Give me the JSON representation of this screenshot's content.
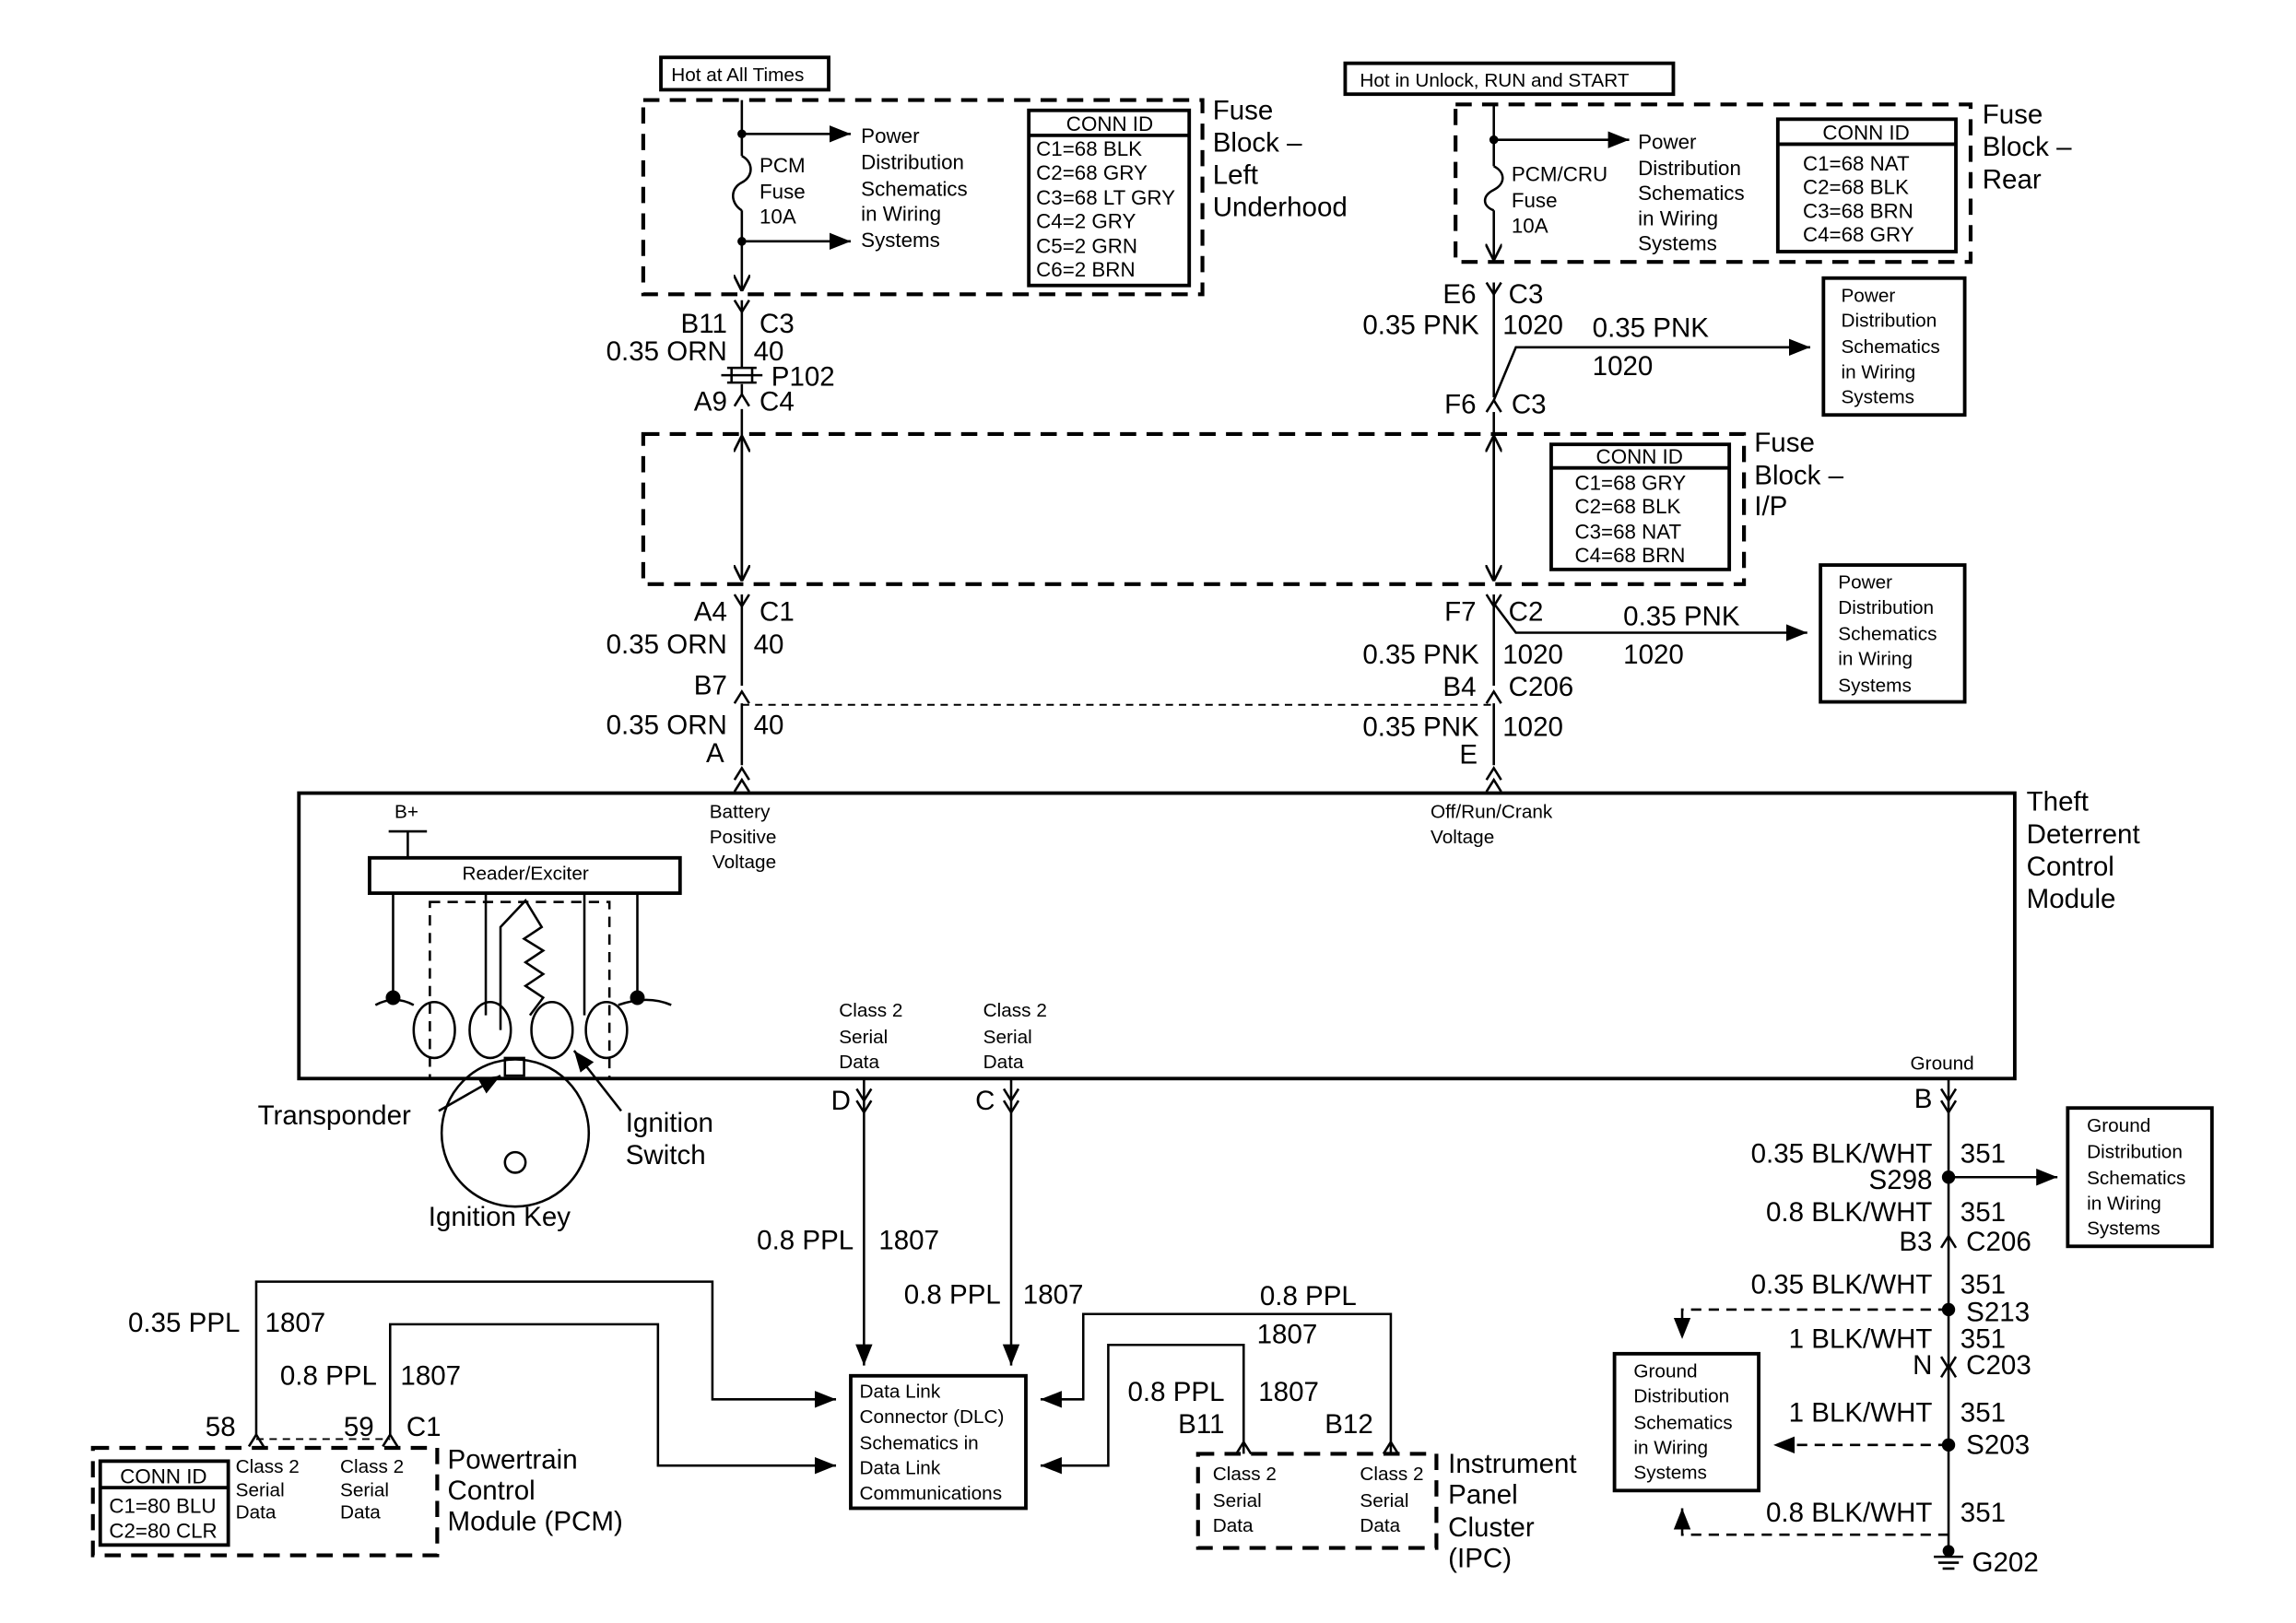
{
  "supply": {
    "hot_at_all_times": "Hot at All Times",
    "hot_in_unlock": "Hot in Unlock, RUN and START"
  },
  "fuse_block_left": {
    "title": [
      "Fuse",
      "Block –",
      "Left",
      "Underhood"
    ],
    "fuse": [
      "PCM",
      "Fuse",
      "10A"
    ],
    "power_dist": [
      "Power",
      "Distribution",
      "Schematics",
      "in Wiring",
      "Systems"
    ],
    "conn_id": {
      "header": "CONN ID",
      "rows": [
        "C1=68 BLK",
        "C2=68 GRY",
        "C3=68 LT GRY",
        "C4=2 GRY",
        "C5=2 GRN",
        "C6=2 BRN"
      ]
    }
  },
  "fuse_block_rear": {
    "title": [
      "Fuse",
      "Block –",
      "Rear"
    ],
    "fuse": [
      "PCM/CRU",
      "Fuse",
      "10A"
    ],
    "power_dist": [
      "Power",
      "Distribution",
      "Schematics",
      "in Wiring",
      "Systems"
    ],
    "conn_id": {
      "header": "CONN ID",
      "rows": [
        "C1=68 NAT",
        "C2=68 BLK",
        "C3=68 BRN",
        "C4=68 GRY"
      ]
    }
  },
  "fuse_block_ip": {
    "title": [
      "Fuse",
      "Block –",
      "I/P"
    ],
    "conn_id": {
      "header": "CONN ID",
      "rows": [
        "C1=68 GRY",
        "C2=68 BLK",
        "C3=68 NAT",
        "C4=68 BRN"
      ]
    }
  },
  "left_circuit": {
    "c3_pin": "B11",
    "c3": "C3",
    "wire1": "0.35 ORN",
    "circ1": "40",
    "splice": "P102",
    "c4_pin": "A9",
    "c4": "C4",
    "c1_pin": "A4",
    "c1": "C1",
    "wire2": "0.35 ORN",
    "circ2": "40",
    "c206_pin": "B7",
    "wire3": "0.35 ORN",
    "circ3": "40",
    "module_pin": "A"
  },
  "right_circuit": {
    "e6": "E6",
    "c3a": "C3",
    "wire1": "0.35 PNK",
    "circ1": "1020",
    "branch1_wire": "0.35 PNK",
    "branch1_circ": "1020",
    "f6": "F6",
    "c3b": "C3",
    "f7": "F7",
    "c2": "C2",
    "branch2_wire": "0.35 PNK",
    "branch2_circ": "1020",
    "wire2": "0.35 PNK",
    "circ2": "1020",
    "b4": "B4",
    "c206": "C206",
    "wire3": "0.35 PNK",
    "circ3": "1020",
    "module_pin": "E"
  },
  "power_dist_box": [
    "Power",
    "Distribution",
    "Schematics",
    "in Wiring",
    "Systems"
  ],
  "module": {
    "title": [
      "Theft",
      "Deterrent",
      "Control",
      "Module"
    ],
    "battery": [
      "Battery",
      "Positive",
      "Voltage"
    ],
    "ignition": [
      "Off/Run/Crank",
      "Voltage"
    ],
    "b_plus": "B+",
    "reader": "Reader/Exciter",
    "class2": [
      "Class 2",
      "Serial",
      "Data"
    ],
    "ground": "Ground",
    "transponder": "Transponder",
    "ignition_switch": [
      "Ignition",
      "Switch"
    ],
    "ignition_key": "Ignition Key"
  },
  "serial": {
    "pin_d": "D",
    "pin_c": "C",
    "wire_d": "0.8 PPL",
    "circ_d": "1807",
    "wire_c": "0.8 PPL",
    "circ_c": "1807",
    "dlc": [
      "Data Link",
      "Connector (DLC)",
      "Schematics in",
      "Data Link",
      "Communications"
    ],
    "pcm_wire1": "0.35 PPL",
    "pcm_circ1": "1807",
    "pcm_wire2": "0.8 PPL",
    "pcm_circ2": "1807",
    "pcm_pin1": "58",
    "pcm_pin2": "59",
    "pcm_conn": "C1",
    "ipc_wire1": "0.8 PPL",
    "ipc_circ1": "1807",
    "ipc_wire2": "0.8 PPL",
    "ipc_circ2": "1807",
    "ipc_pin1": "B11",
    "ipc_pin2": "B12"
  },
  "pcm": {
    "title": [
      "Powertrain",
      "Control",
      "Module (PCM)"
    ],
    "conn_id": {
      "header": "CONN ID",
      "rows": [
        "C1=80 BLU",
        "C2=80 CLR"
      ]
    },
    "class2": [
      "Class 2",
      "Serial",
      "Data"
    ]
  },
  "ipc": {
    "title": [
      "Instrument",
      "Panel",
      "Cluster",
      "(IPC)"
    ],
    "class2": [
      "Class 2",
      "Serial",
      "Data"
    ]
  },
  "ground_circuit": {
    "pin": "B",
    "w1": "0.35 BLK/WHT",
    "c1": "351",
    "s298": "S298",
    "w2": "0.8 BLK/WHT",
    "c2": "351",
    "b3": "B3",
    "c206": "C206",
    "w3": "0.35 BLK/WHT",
    "c3": "351",
    "s213": "S213",
    "w4": "1 BLK/WHT",
    "c4": "351",
    "n": "N",
    "c203": "C203",
    "w5": "1 BLK/WHT",
    "c5": "351",
    "s203": "S203",
    "w6": "0.8 BLK/WHT",
    "c6": "351",
    "g202": "G202",
    "ground_dist": [
      "Ground",
      "Distribution",
      "Schematics",
      "in Wiring",
      "Systems"
    ]
  }
}
